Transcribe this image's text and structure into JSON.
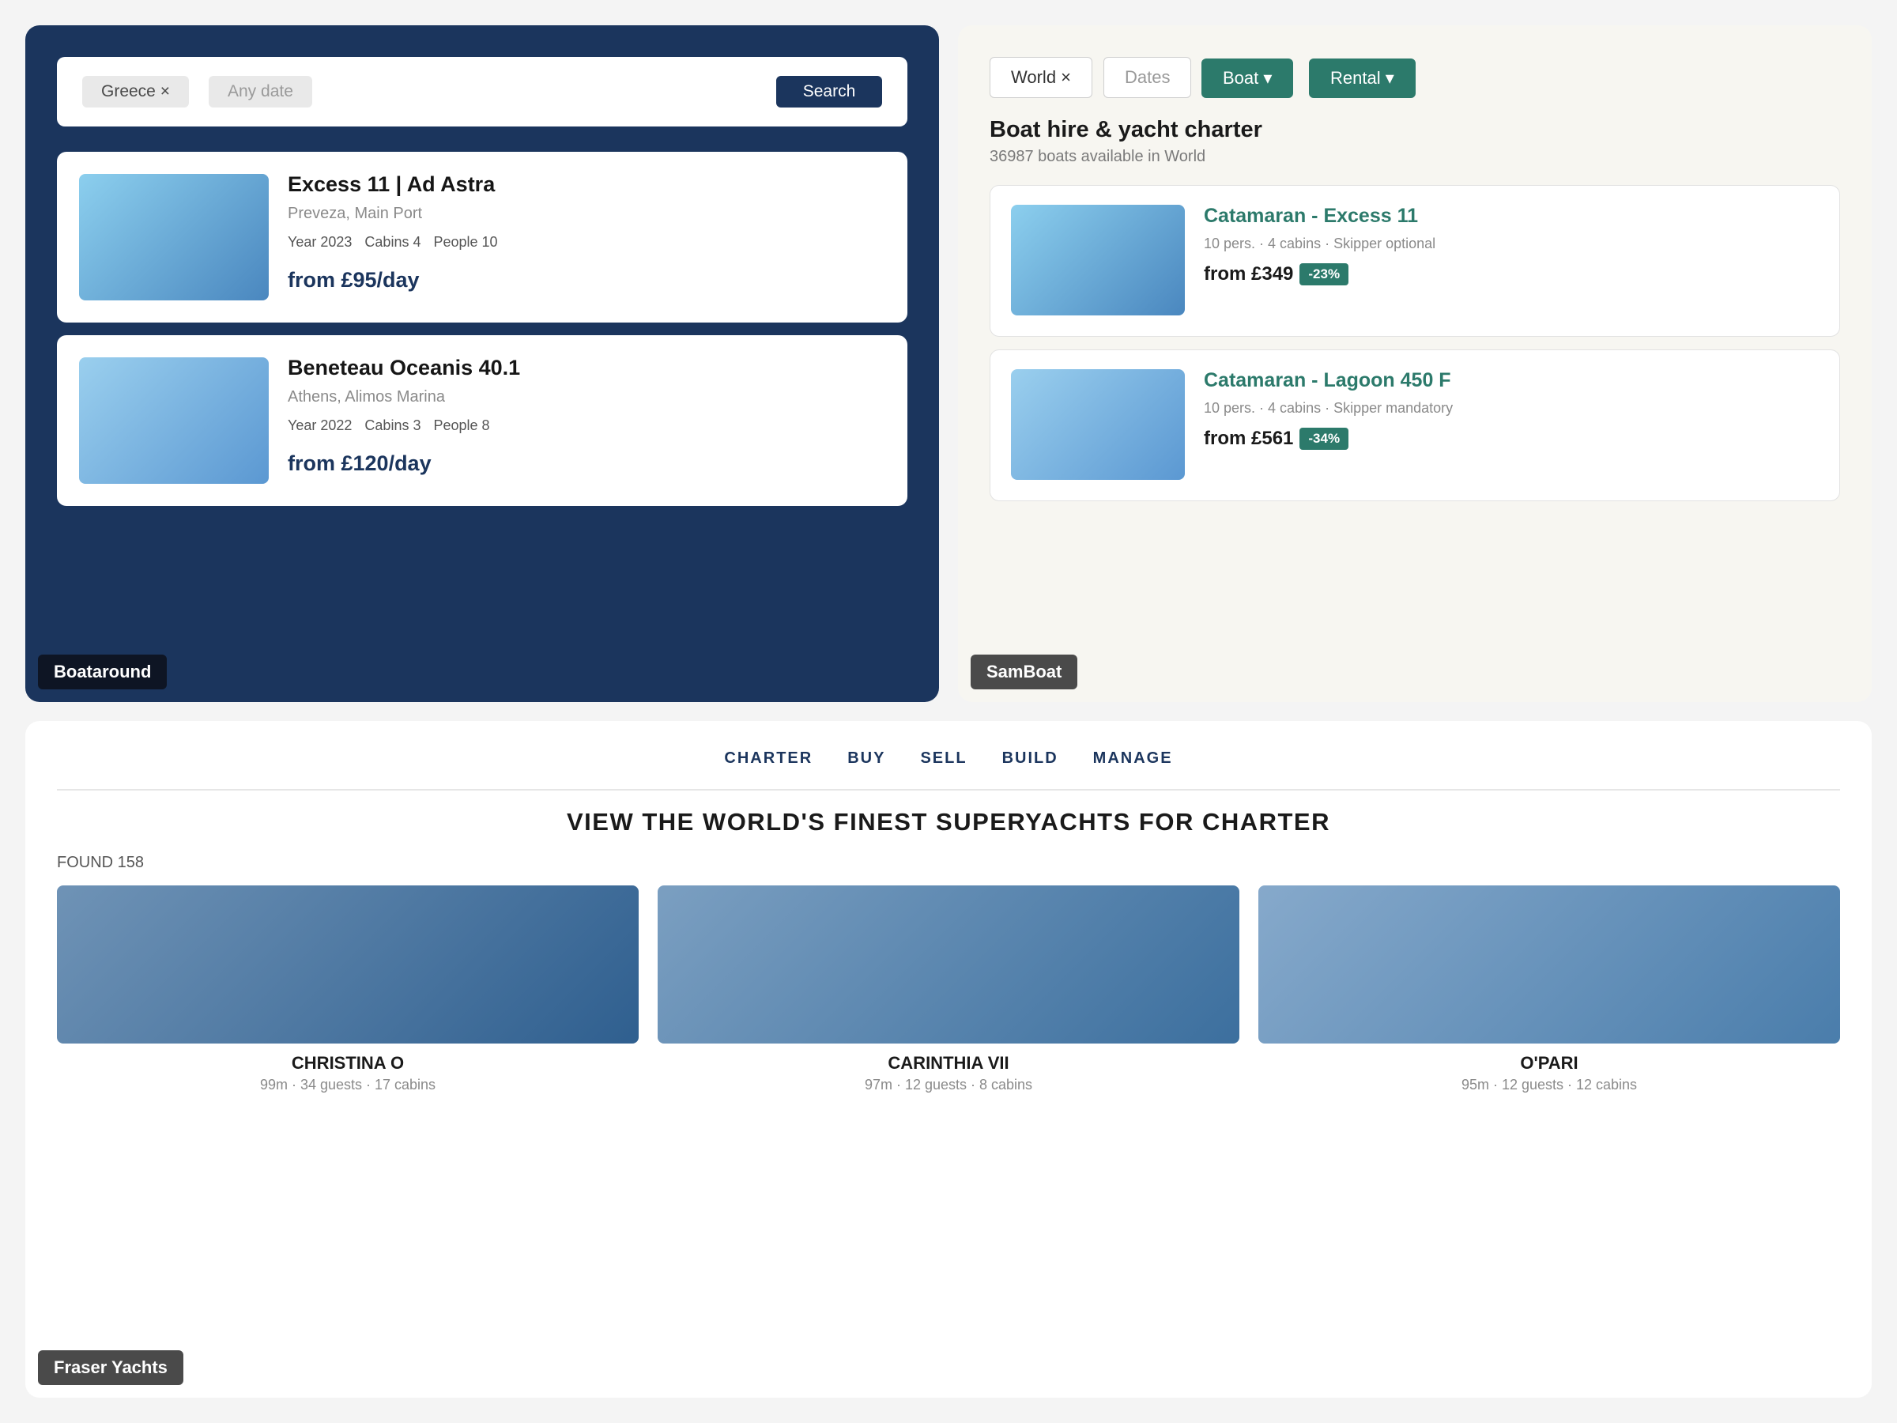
{
  "boataround": {
    "brand": "Boataround",
    "search": {
      "location": "Greece ×",
      "date_placeholder": "Any date",
      "button": "Search"
    },
    "listings": [
      {
        "title": "Excess 11 | Ad Astra",
        "location": "Preveza, Main Port",
        "year": "Year 2023",
        "cabins": "Cabins 4",
        "people": "People 10",
        "price": "from £95/day"
      },
      {
        "title": "Beneteau Oceanis 40.1",
        "location": "Athens, Alimos Marina",
        "year": "Year 2022",
        "cabins": "Cabins 3",
        "people": "People 8",
        "price": "from £120/day"
      }
    ]
  },
  "samboat": {
    "brand": "SamBoat",
    "filters": {
      "world": "World ×",
      "dates": "Dates",
      "boat": "Boat ▾",
      "rental": "Rental ▾"
    },
    "heading": "Boat hire & yacht charter",
    "subheading": "36987 boats available in World",
    "listings": [
      {
        "title": "Catamaran - Excess 11",
        "meta": "10 pers. · 4 cabins · Skipper optional",
        "price": "from £349",
        "discount": "-23%"
      },
      {
        "title": "Catamaran - Lagoon 450 F",
        "meta": "10 pers. · 4 cabins · Skipper mandatory",
        "price": "from £561",
        "discount": "-34%"
      }
    ]
  },
  "fraser": {
    "brand": "Fraser Yachts",
    "nav": [
      "CHARTER",
      "BUY",
      "SELL",
      "BUILD",
      "MANAGE"
    ],
    "heading": "VIEW THE WORLD'S FINEST SUPERYACHTS FOR CHARTER",
    "found": "FOUND 158",
    "yachts": [
      {
        "name": "CHRISTINA O",
        "meta": "99m · 34 guests · 17 cabins"
      },
      {
        "name": "CARINTHIA VII",
        "meta": "97m · 12 guests · 8 cabins"
      },
      {
        "name": "O'PARI",
        "meta": "95m · 12 guests · 12 cabins"
      }
    ]
  },
  "colors": {
    "boataround_navy": "#1b355d",
    "samboat_teal": "#2c7a6b",
    "samboat_bg": "#f7f6f1"
  }
}
